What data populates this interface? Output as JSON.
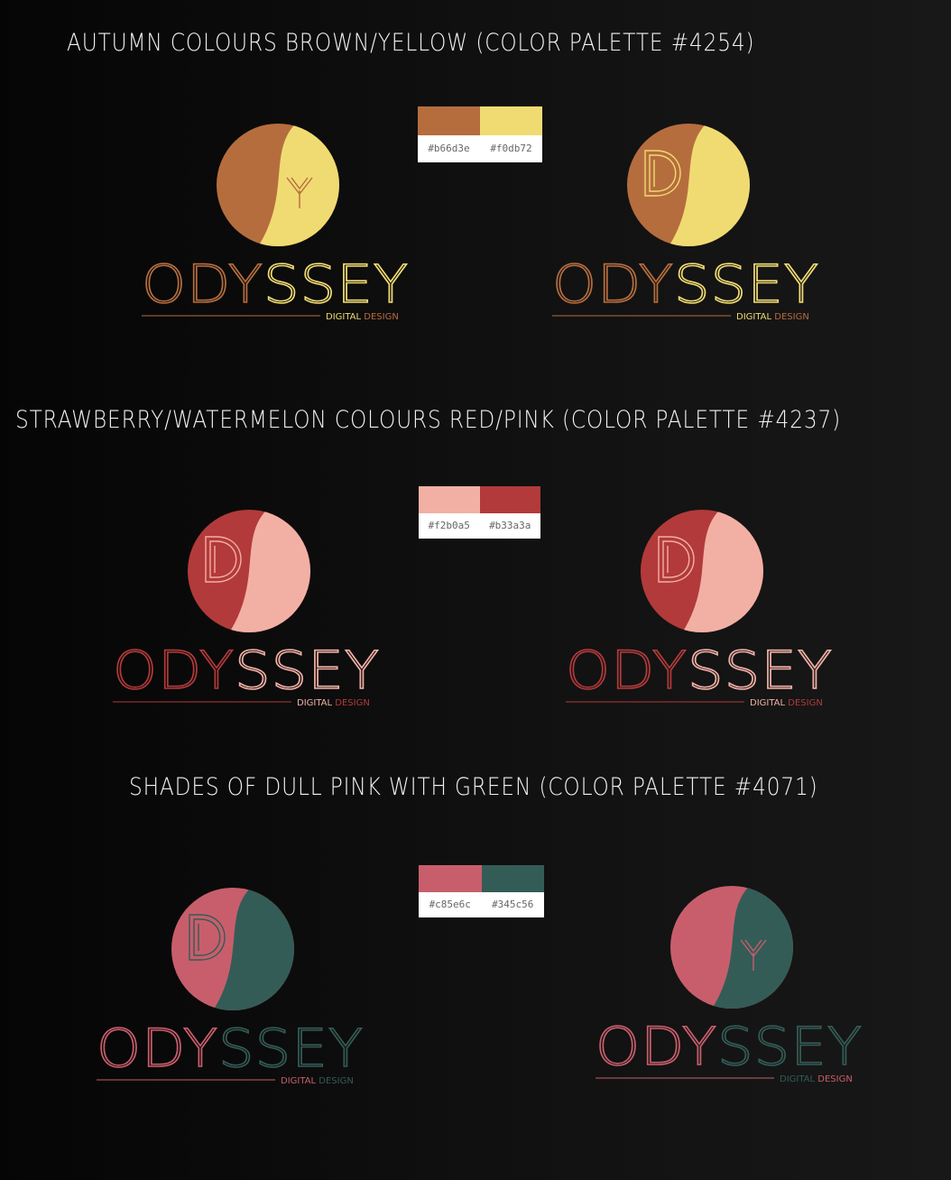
{
  "sections": [
    {
      "title": "AUTUMN COLOURS BROWN/YELLOW (COLOR PALETTE #4254)",
      "palette": [
        {
          "hex": "#b66d3e",
          "label": "#b66d3e"
        },
        {
          "hex": "#f0db72",
          "label": "#f0db72"
        }
      ],
      "logos": [
        {
          "brand": "ODYSSEY",
          "brand_split": [
            "ODY",
            "SSEY"
          ],
          "tagline_a": "DIGITAL",
          "tagline_b": "DESIGN",
          "color_a": "#b66d3e",
          "color_b": "#f0db72",
          "tagline_a_color": "#f0db72",
          "tagline_b_color": "#b66d3e",
          "monogram_color": "#b66d3e"
        },
        {
          "brand": "ODYSSEY",
          "brand_split": [
            "ODY",
            "SSEY"
          ],
          "tagline_a": "DIGITAL",
          "tagline_b": "DESIGN",
          "color_a": "#b66d3e",
          "color_b": "#f0db72",
          "tagline_a_color": "#f0db72",
          "tagline_b_color": "#b66d3e",
          "monogram_color": "#f0db72"
        }
      ]
    },
    {
      "title": "STRAWBERRY/WATERMELON COLOURS RED/PINK (COLOR PALETTE #4237)",
      "palette": [
        {
          "hex": "#f2b0a5",
          "label": "#f2b0a5"
        },
        {
          "hex": "#b33a3a",
          "label": "#b33a3a"
        }
      ],
      "logos": [
        {
          "brand": "ODYSSEY",
          "brand_split": [
            "ODY",
            "SSEY"
          ],
          "tagline_a": "DIGITAL",
          "tagline_b": "DESIGN",
          "color_a": "#b33a3a",
          "color_b": "#f2b0a5",
          "tagline_a_color": "#f2b0a5",
          "tagline_b_color": "#b33a3a",
          "monogram_color": "#f2b0a5"
        },
        {
          "brand": "ODYSSEY",
          "brand_split": [
            "ODY",
            "SSEY"
          ],
          "tagline_a": "DIGITAL",
          "tagline_b": "DESIGN",
          "color_a": "#b33a3a",
          "color_b": "#f2b0a5",
          "tagline_a_color": "#f2b0a5",
          "tagline_b_color": "#b33a3a",
          "monogram_color": "#f2b0a5"
        }
      ]
    },
    {
      "title": "SHADES OF DULL PINK WITH GREEN (COLOR PALETTE #4071)",
      "palette": [
        {
          "hex": "#c85e6c",
          "label": "#c85e6c"
        },
        {
          "hex": "#345c56",
          "label": "#345c56"
        }
      ],
      "logos": [
        {
          "brand": "ODYSSEY",
          "brand_split": [
            "ODY",
            "SSEY"
          ],
          "tagline_a": "DIGITAL",
          "tagline_b": "DESIGN",
          "color_a": "#c85e6c",
          "color_b": "#345c56",
          "tagline_a_color": "#c85e6c",
          "tagline_b_color": "#345c56",
          "monogram_color": "#345c56"
        },
        {
          "brand": "ODYSSEY",
          "brand_split": [
            "ODY",
            "SSEY"
          ],
          "tagline_a": "DIGITAL",
          "tagline_b": "DESIGN",
          "color_a": "#c85e6c",
          "color_b": "#345c56",
          "tagline_a_color": "#345c56",
          "tagline_b_color": "#c85e6c",
          "monogram_color": "#c85e6c"
        }
      ]
    }
  ]
}
